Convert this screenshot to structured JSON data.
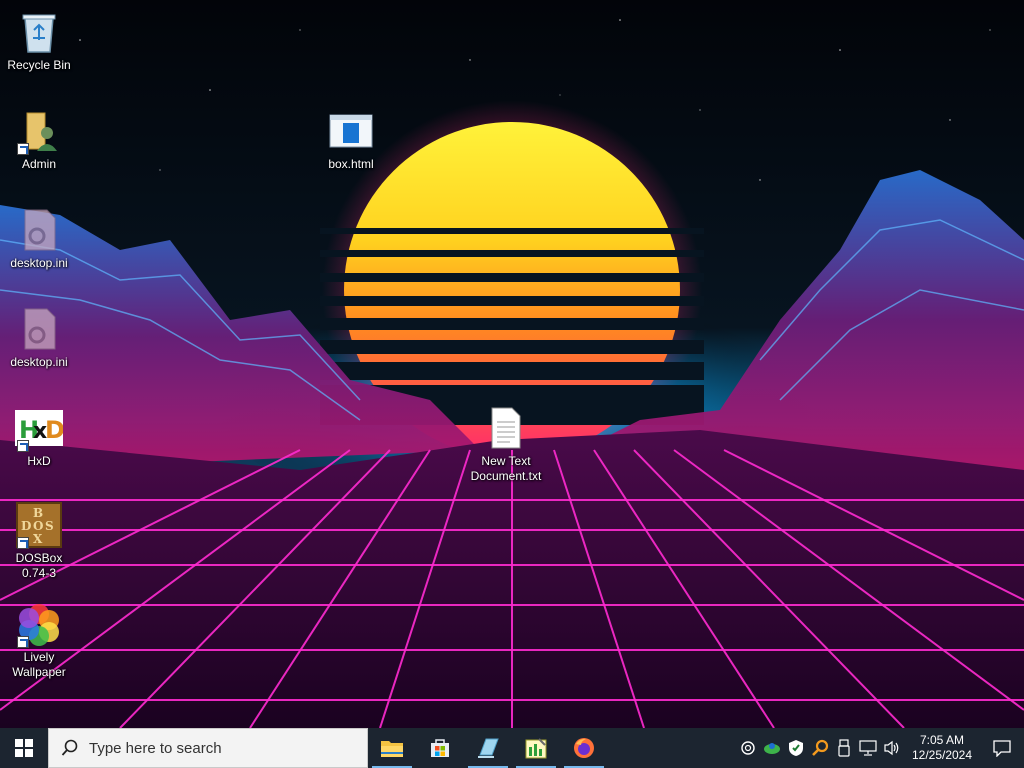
{
  "desktop": {
    "icons": [
      {
        "label": "Recycle Bin",
        "icon": "recycle-bin-icon"
      },
      {
        "label": "Admin",
        "icon": "user-folder-icon"
      },
      {
        "label": "box.html",
        "icon": "html-file-icon"
      },
      {
        "label": "desktop.ini",
        "icon": "settings-file-icon"
      },
      {
        "label": "desktop.ini",
        "icon": "settings-file-icon"
      },
      {
        "label": "HxD",
        "icon": "hxd-app-icon"
      },
      {
        "label": "New Text\nDocument.txt",
        "icon": "text-file-icon"
      },
      {
        "label": "DOSBox\n0.74-3",
        "icon": "dosbox-app-icon"
      },
      {
        "label": "Lively\nWallpaper",
        "icon": "lively-wallpaper-icon"
      }
    ]
  },
  "taskbar": {
    "search_placeholder": "Type here to search",
    "apps": [
      {
        "name": "File Explorer",
        "icon": "file-explorer-icon",
        "running": true
      },
      {
        "name": "Microsoft Store",
        "icon": "store-icon",
        "running": false
      },
      {
        "name": "Notepad-like app",
        "icon": "editor-icon",
        "running": true
      },
      {
        "name": "Task app",
        "icon": "chart-app-icon",
        "running": true
      },
      {
        "name": "Firefox",
        "icon": "firefox-icon",
        "running": true
      }
    ],
    "tray_icons": [
      "network-status-icon",
      "green-app-icon",
      "security-shield-icon",
      "search-tool-icon",
      "usb-icon",
      "network-icon",
      "volume-icon"
    ],
    "clock": {
      "time": "7:05 AM",
      "date": "12/25/2024"
    }
  },
  "colors": {
    "taskbar": "#1c2530",
    "accent": "#76b9ed",
    "grid_pink": "#ff2bd1",
    "sun_yellow": "#ffe22b",
    "sun_orange": "#ff8a1f"
  }
}
